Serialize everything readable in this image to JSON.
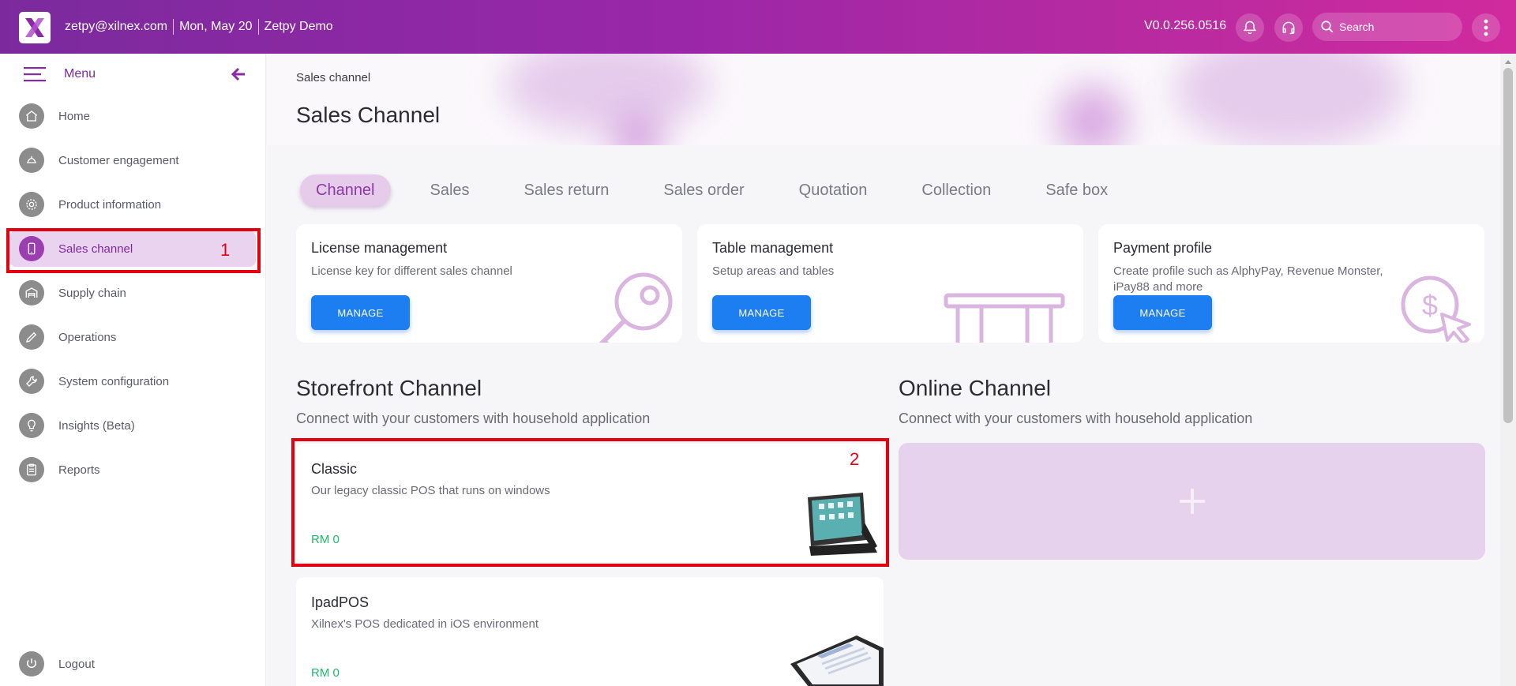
{
  "topbar": {
    "email": "zetpy@xilnex.com",
    "date": "Mon, May 20",
    "company": "Zetpy Demo",
    "version": "V0.0.256.0516",
    "search_placeholder": "Search"
  },
  "sidebar": {
    "menu_label": "Menu",
    "items": [
      {
        "label": "Home",
        "icon": "home-icon"
      },
      {
        "label": "Customer engagement",
        "icon": "handshake-icon"
      },
      {
        "label": "Product information",
        "icon": "gear-icon"
      },
      {
        "label": "Sales channel",
        "icon": "mobile-icon"
      },
      {
        "label": "Supply chain",
        "icon": "warehouse-icon"
      },
      {
        "label": "Operations",
        "icon": "pen-icon"
      },
      {
        "label": "System configuration",
        "icon": "wrench-icon"
      },
      {
        "label": "Insights (Beta)",
        "icon": "lightbulb-icon"
      },
      {
        "label": "Reports",
        "icon": "clipboard-icon"
      }
    ],
    "logout_label": "Logout",
    "annotation_1": "1"
  },
  "main": {
    "breadcrumb": "Sales channel",
    "title": "Sales Channel",
    "tabs": [
      "Channel",
      "Sales",
      "Sales return",
      "Sales order",
      "Quotation",
      "Collection",
      "Safe box"
    ],
    "cards": [
      {
        "title": "License management",
        "desc": "License key for different sales channel",
        "button": "MANAGE",
        "art": "key-icon"
      },
      {
        "title": "Table management",
        "desc": "Setup areas and tables",
        "button": "MANAGE",
        "art": "table-icon"
      },
      {
        "title": "Payment profile",
        "desc": "Create profile such as AlphyPay, Revenue Monster, iPay88 and more",
        "button": "MANAGE",
        "art": "payment-cursor-icon"
      }
    ],
    "storefront": {
      "title": "Storefront Channel",
      "subtitle": "Connect with your customers with household application",
      "channels": [
        {
          "title": "Classic",
          "desc": "Our legacy classic POS that runs on windows",
          "price": "RM 0"
        },
        {
          "title": "IpadPOS",
          "desc": "Xilnex's POS dedicated in iOS environment",
          "price": "RM 0"
        }
      ],
      "annotation_2": "2"
    },
    "online": {
      "title": "Online Channel",
      "subtitle": "Connect with your customers with household application"
    }
  },
  "colors": {
    "brand": "#8a2aa5",
    "button": "#1c7ef0",
    "price": "#1fb86b",
    "annotation": "#e3000f"
  }
}
